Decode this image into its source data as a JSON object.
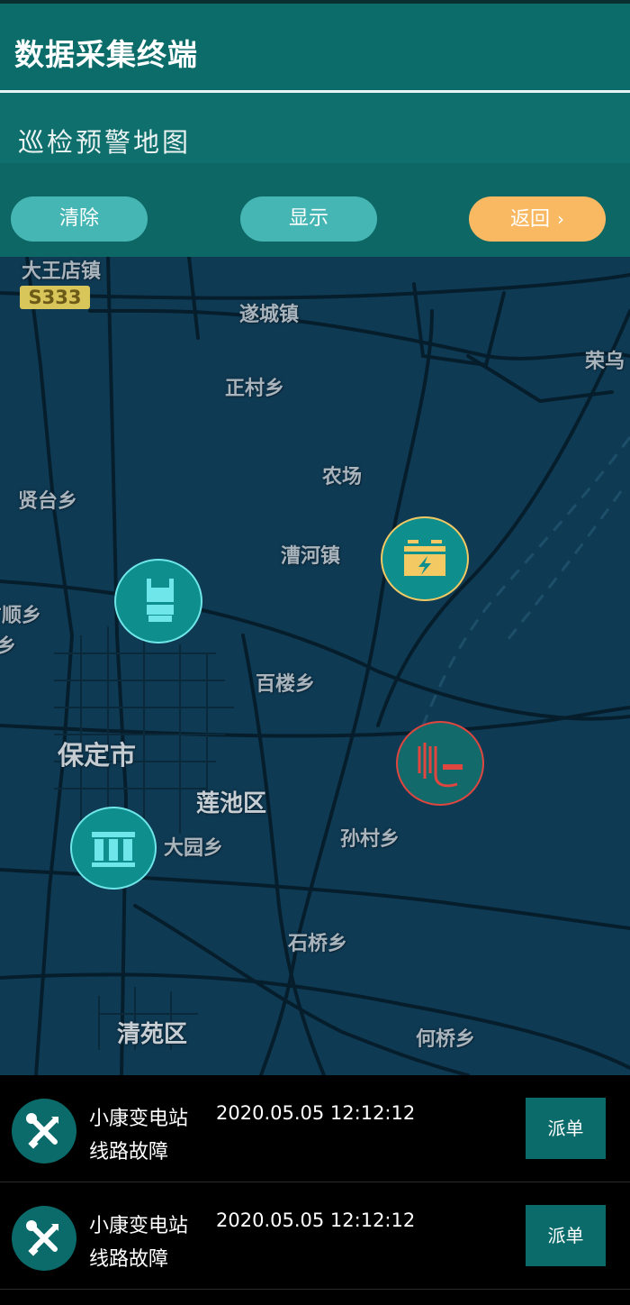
{
  "header": {
    "title": "数据采集终端"
  },
  "subheader": {
    "title": "巡检预警地图"
  },
  "toolbar": {
    "clear_label": "清除",
    "show_label": "显示",
    "back_label": "返回",
    "back_icon": "chevron-right-icon"
  },
  "map": {
    "road_badge": "S333",
    "places": {
      "dawangdian": "大王店镇",
      "suicheng": "遂城镇",
      "zhengcun": "正村乡",
      "nongchang": "农场",
      "xiantai": "贤台乡",
      "caohe": "漕河镇",
      "fangshun": "方顺乡",
      "xiang_edge": "乡",
      "bailou": "百楼乡",
      "baoding": "保定市",
      "lianchi": "莲池区",
      "dayuan": "大园乡",
      "suncun": "孙村乡",
      "shiqiao": "石桥乡",
      "qingyuan": "清苑区",
      "heqiao": "何桥乡",
      "rongcheng_edge": "荣乌"
    },
    "markers": [
      {
        "icon": "transformer-icon",
        "color": "#6fe6ea"
      },
      {
        "icon": "battery-charge-icon",
        "color": "#f2c963"
      },
      {
        "icon": "cable-reel-icon",
        "color": "#e04640"
      },
      {
        "icon": "substation-icon",
        "color": "#6fe6ea"
      }
    ]
  },
  "alerts": [
    {
      "station": "小康变电站",
      "time": "2020.05.05 12:12:12",
      "type": "线路故障",
      "action": "派单",
      "icon": "tools-icon"
    },
    {
      "station": "小康变电站",
      "time": "2020.05.05 12:12:12",
      "type": "线路故障",
      "action": "派单",
      "icon": "tools-icon"
    }
  ],
  "colors": {
    "header": "#0b6c6a",
    "pill": "#46b6b4",
    "back": "#f8b962",
    "map_bg": "#0f3a53",
    "accent_dark": "#0a6b6a"
  }
}
